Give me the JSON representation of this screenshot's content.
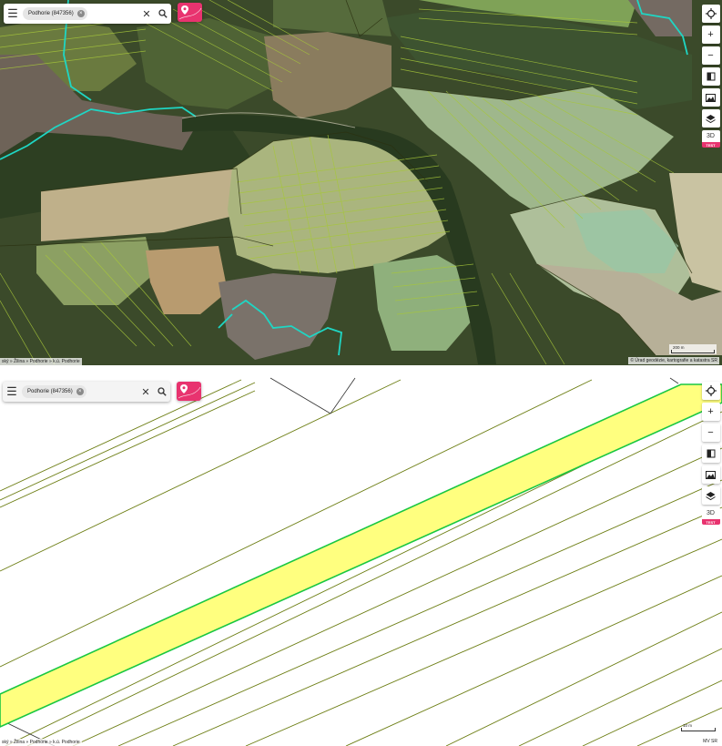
{
  "top_view": {
    "search_chip": "Podhorie (847356)",
    "breadcrumb": "ský » Žilina » Podhorie » k.ú. Podhorie",
    "attribution": "© Úrad geodézie, kartografie a katastra SR",
    "scale_label": "200 m",
    "badge_3d": "3D",
    "badge_test": "TEST"
  },
  "bottom_view": {
    "search_chip": "Podhorie (847356)",
    "breadcrumb": "ský » Žilina » Podhorie » k.ú. Podhorie",
    "attribution": "MV SR",
    "scale_label": "10 m",
    "badge_3d": "3D",
    "badge_test": "TEST"
  },
  "icons": {
    "menu": "menu-icon",
    "chip_remove": "close-circle-icon",
    "clear": "close-icon",
    "search": "search-icon",
    "location_pin": "map-pin-icon",
    "locate": "crosshair-icon",
    "zoom_in": "plus-icon",
    "zoom_out": "minus-icon",
    "compare": "split-view-icon",
    "map_image": "map-photo-icon",
    "layers": "layers-icon"
  },
  "colors": {
    "parcel_line": "#a7c73a",
    "parcel_line_dark": "#3a4010",
    "selected_parcel_fill": "#ffff7f",
    "selected_parcel_border": "#19c742",
    "municipality_border": "#1fd6c4",
    "accent": "#e8336f"
  }
}
